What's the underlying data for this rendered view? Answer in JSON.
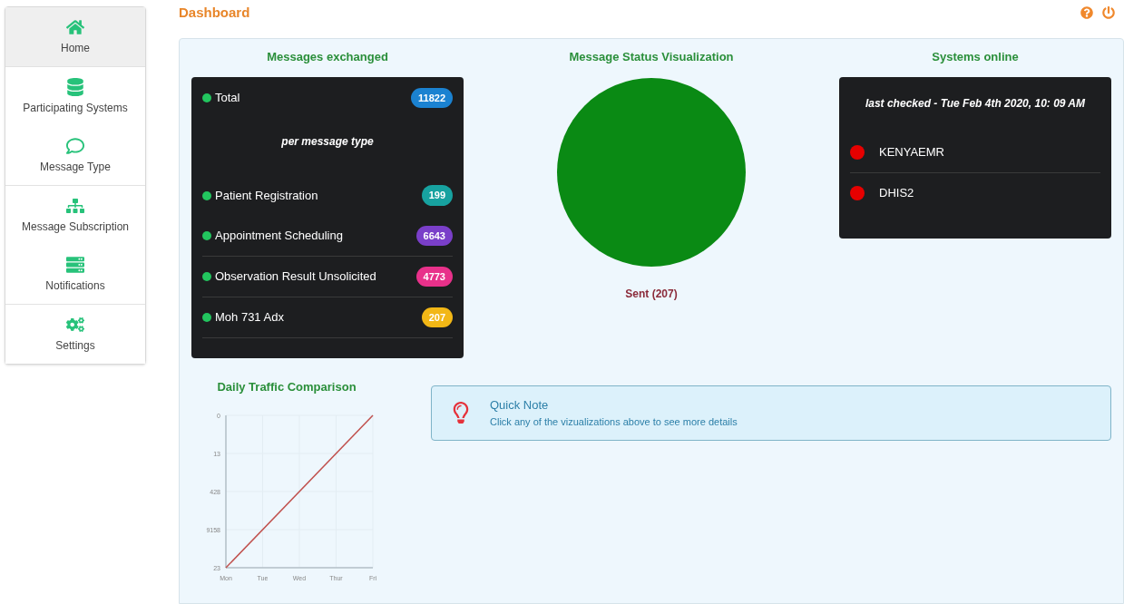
{
  "sidebar": {
    "groups": [
      {
        "items": [
          {
            "label": "Home",
            "kind": "home",
            "selected": true
          }
        ]
      },
      {
        "items": [
          {
            "label": "Participating Systems",
            "kind": "database",
            "selected": false
          },
          {
            "label": "Message Type",
            "kind": "chat",
            "selected": false
          }
        ]
      },
      {
        "items": [
          {
            "label": "Message Subscription",
            "kind": "sitemap",
            "selected": false
          },
          {
            "label": "Notifications",
            "kind": "server",
            "selected": false
          }
        ]
      },
      {
        "items": [
          {
            "label": "Settings",
            "kind": "gears",
            "selected": false
          }
        ]
      }
    ]
  },
  "header": {
    "title": "Dashboard"
  },
  "messages": {
    "title": "Messages exchanged",
    "total": {
      "label": "Total",
      "count": "11822",
      "color": "#1b82d1"
    },
    "subtitle": "per message type",
    "types": [
      {
        "label": "Patient Registration",
        "count": "199",
        "color": "#17a2a0"
      },
      {
        "label": "Appointment Scheduling",
        "count": "6643",
        "color": "#7a3fc9"
      },
      {
        "label": "Observation Result Unsolicited",
        "count": "4773",
        "color": "#e8318a"
      },
      {
        "label": "Moh 731 Adx",
        "count": "207",
        "color": "#f2b716"
      }
    ]
  },
  "status": {
    "title": "Message Status Visualization",
    "legend": "Sent (207)"
  },
  "systems": {
    "title": "Systems online",
    "last_checked": "last checked - Tue Feb 4th 2020, 10: 09 AM",
    "items": [
      {
        "name": "KENYAEMR",
        "online": false
      },
      {
        "name": "DHIS2",
        "online": false
      }
    ]
  },
  "traffic": {
    "title": "Daily Traffic Comparison",
    "y_labels": [
      "0",
      "13",
      "428",
      "9158",
      "23"
    ],
    "x_labels": [
      "Mon",
      "Tue",
      "Wed",
      "Thur",
      "Fri"
    ]
  },
  "note": {
    "title": "Quick Note",
    "text": "Click any of the vizualizations above to see more details"
  }
}
